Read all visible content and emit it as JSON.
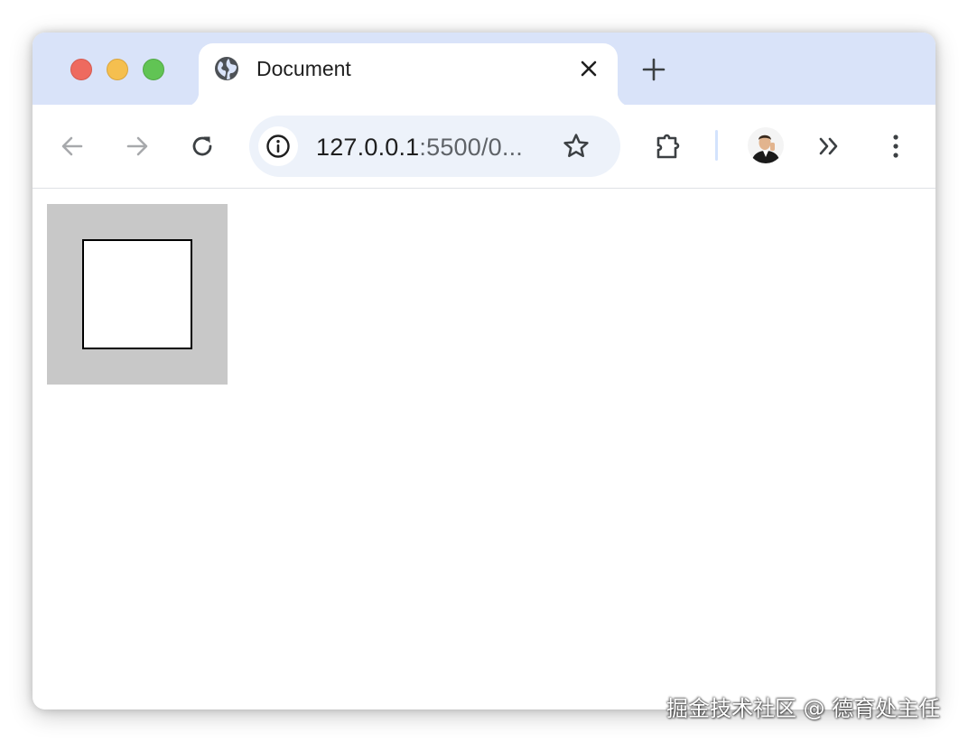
{
  "window": {
    "controls": [
      "close",
      "minimize",
      "maximize"
    ]
  },
  "tab": {
    "title": "Document",
    "favicon": "globe-icon",
    "close_icon": "close-icon"
  },
  "new_tab_icon": "plus-icon",
  "toolbar": {
    "back_icon": "arrow-left-icon",
    "forward_icon": "arrow-right-icon",
    "reload_icon": "reload-icon",
    "site_info_icon": "info-icon",
    "url_host": "127.0.0.1",
    "url_rest": ":5500/0...",
    "bookmark_icon": "star-icon",
    "extensions_icon": "puzzle-icon",
    "profile_icon": "avatar",
    "overflow_icon": "chevron-double-right-icon",
    "menu_icon": "more-vertical-icon"
  },
  "colors": {
    "titlebar": "#d9e3f9",
    "omnibox": "#edf2fa",
    "outer_box": "#c8c8c8",
    "inner_box": "#ffffff",
    "inner_border": "#000000"
  },
  "watermark": "掘金技术社区 @ 德育处主任"
}
